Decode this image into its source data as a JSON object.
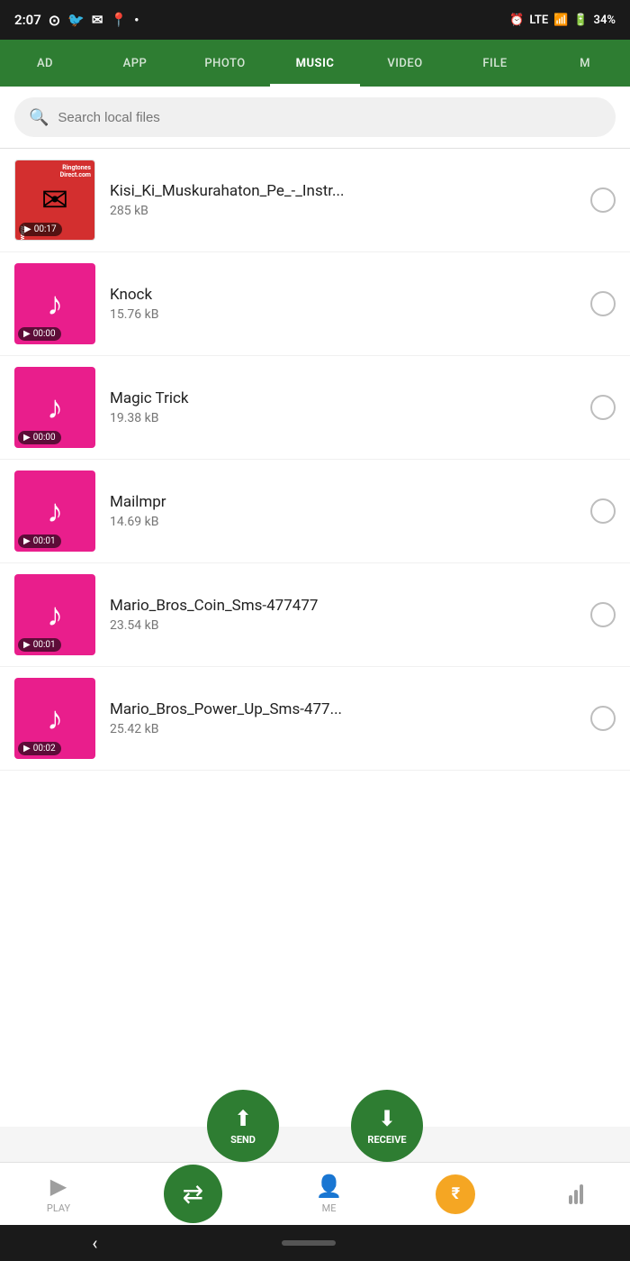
{
  "status": {
    "time": "2:07",
    "battery": "34%",
    "network": "LTE"
  },
  "nav": {
    "tabs": [
      "AD",
      "APP",
      "PHOTO",
      "MUSIC",
      "VIDEO",
      "FILE",
      "M"
    ],
    "active": "MUSIC"
  },
  "search": {
    "placeholder": "Search local files"
  },
  "files": [
    {
      "name": "Kisi_Ki_Muskurahaton_Pe_-_Instr...",
      "size": "285 kB",
      "duration": "00:17",
      "thumb": "ringtones"
    },
    {
      "name": "Knock",
      "size": "15.76 kB",
      "duration": "00:00",
      "thumb": "pink"
    },
    {
      "name": "Magic Trick",
      "size": "19.38 kB",
      "duration": "00:00",
      "thumb": "pink"
    },
    {
      "name": "Mailmpr",
      "size": "14.69 kB",
      "duration": "00:01",
      "thumb": "pink"
    },
    {
      "name": "Mario_Bros_Coin_Sms-477477",
      "size": "23.54 kB",
      "duration": "00:01",
      "thumb": "pink"
    },
    {
      "name": "Mario_Bros_Power_Up_Sms-477...",
      "size": "25.42 kB",
      "duration": "00:02",
      "thumb": "pink"
    }
  ],
  "actions": {
    "send": "SEND",
    "receive": "RECEIVE"
  },
  "bottomNav": {
    "play": "PLAY",
    "me": "ME"
  }
}
